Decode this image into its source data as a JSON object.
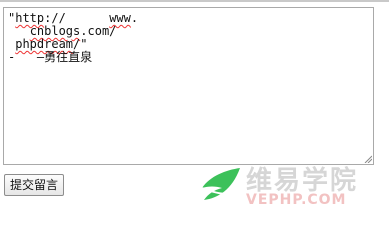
{
  "form": {
    "textarea": {
      "line1_prefix": "\"",
      "line1_word1": "http",
      "line1_colon": "://",
      "line1_gap": "      ",
      "line1_word2": "www",
      "line1_dot": ".",
      "line2_indent": "   ",
      "line2_word": "cnblogs",
      "line2_rest": ".com/",
      "line3_indent": " ",
      "line3_word": "phpdream",
      "line3_rest": "/\"",
      "line4": "-   —勇往直泉"
    },
    "submit_label": "提交留言"
  },
  "watermark": {
    "title": "维易学院",
    "url": "VEPHP.COM",
    "colors": {
      "logo_green": "#3cc15a",
      "text_gray": "#d6d6d6",
      "url_pink": "#f2c2c2"
    }
  }
}
